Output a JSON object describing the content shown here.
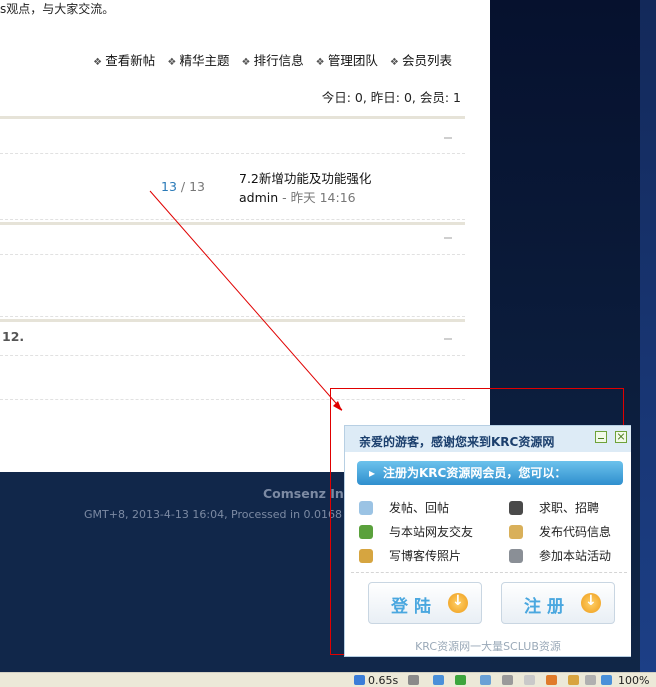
{
  "forum_page": {
    "intro_text": "s观点，与大家交流。",
    "nav_links": [
      "查看新帖",
      "精华主题",
      "排行信息",
      "管理团队",
      "会员列表"
    ],
    "stats": "今日: 0, 昨日: 0, 会员: 1",
    "forum_row": {
      "count_a": "13",
      "count_sep": " / ",
      "count_b": "13",
      "last_post_title": "7.2新增功能及功能强化",
      "last_post_user": "admin",
      "last_post_time": " - 昨天 14:16"
    },
    "partial_text": "12."
  },
  "footer": {
    "brand": "Comsenz Inc",
    "info": "GMT+8, 2013-4-13 16:04, Processed in 0.0168"
  },
  "popup": {
    "title": "亲爱的游客，感谢您来到KRC资源网",
    "banner": "注册为KRC资源网会员，您可以：",
    "features": [
      {
        "label": "发帖、回帖",
        "icon": "pencil-icon"
      },
      {
        "label": "求职、招聘",
        "icon": "person-icon"
      },
      {
        "label": "与本站网友交友",
        "icon": "add-friend-icon"
      },
      {
        "label": "发布代码信息",
        "icon": "clipboard-icon"
      },
      {
        "label": "写博客传照片",
        "icon": "blog-icon"
      },
      {
        "label": "参加本站活动",
        "icon": "user-gear-icon"
      }
    ],
    "login_label": "登陆",
    "register_label": "注册",
    "footer_text": "KRC资源网一大量SCLUB资源"
  },
  "statusbar": {
    "load_time": "0.65s",
    "zoom": "100%"
  },
  "colors": {
    "accent_blue": "#2f8fce",
    "popup_title": "#1b3f6d",
    "annotation_red": "#e00000",
    "footer_bg": "#11274a"
  }
}
